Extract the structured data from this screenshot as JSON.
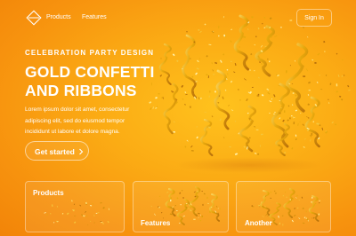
{
  "nav": {
    "links": [
      "Products",
      "Features"
    ],
    "signin": "Sign In",
    "logo_icon": "diamond-logo-icon"
  },
  "hero": {
    "eyebrow": "CELEBRATION PARTY DESIGN",
    "title_lines": [
      "GOLD CONFETTI",
      "AND RIBBONS"
    ],
    "body_lines": [
      "Lorem ipsum dolor sit amet, consectetur",
      "adipiscing elit, sed do eiusmod tempor",
      "incididunt ut labore et dolore magna."
    ],
    "cta": "Get started",
    "cta_icon": "chevron-right-icon"
  },
  "cards": [
    {
      "title": "Products"
    },
    {
      "title": "Features"
    },
    {
      "title": "Another"
    }
  ],
  "colors": {
    "background": "#fbab14",
    "background_edge": "#f28408",
    "gold_light": "#ffe37a",
    "gold": "#e7a80d",
    "gold_dark": "#b8700a",
    "text": "#ffffff"
  }
}
